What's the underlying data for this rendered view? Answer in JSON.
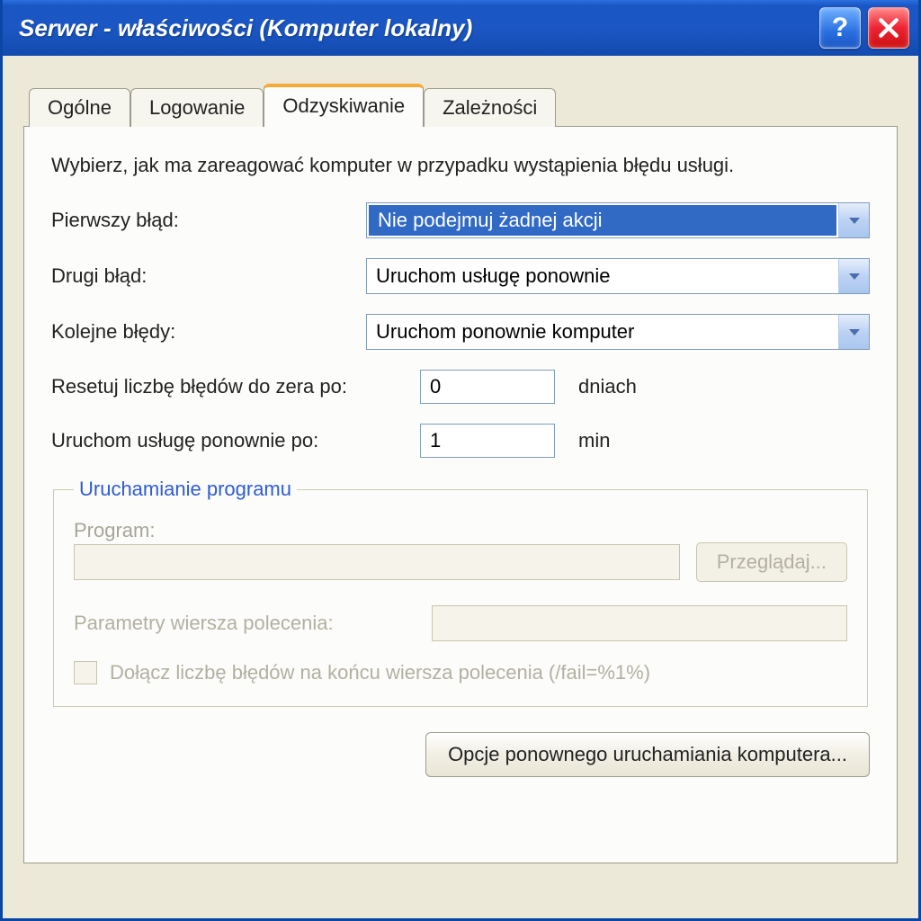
{
  "window": {
    "title": "Serwer - właściwości (Komputer lokalny)"
  },
  "tabs": {
    "general": "Ogólne",
    "logon": "Logowanie",
    "recovery": "Odzyskiwanie",
    "dependencies": "Zależności"
  },
  "recovery": {
    "description": "Wybierz, jak ma zareagować komputer w przypadku wystąpienia błędu usługi.",
    "first_label": "Pierwszy błąd:",
    "first_value": "Nie podejmuj żadnej akcji",
    "second_label": "Drugi błąd:",
    "second_value": "Uruchom usługę ponownie",
    "subsequent_label": "Kolejne błędy:",
    "subsequent_value": "Uruchom ponownie komputer",
    "reset_label": "Resetuj liczbę błędów do zera po:",
    "reset_value": "0",
    "reset_unit": "dniach",
    "restart_label": "Uruchom usługę ponownie po:",
    "restart_value": "1",
    "restart_unit": "min"
  },
  "program_group": {
    "legend": "Uruchamianie programu",
    "program_label": "Program:",
    "program_value": "",
    "browse_label": "Przeglądaj...",
    "params_label": "Parametry wiersza polecenia:",
    "params_value": "",
    "append_label": "Dołącz liczbę błędów na końcu wiersza polecenia (/fail=%1%)"
  },
  "buttons": {
    "restart_options": "Opcje ponownego uruchamiania komputera..."
  }
}
